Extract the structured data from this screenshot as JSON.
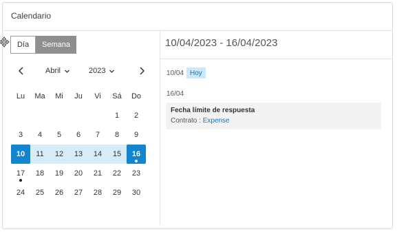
{
  "panel": {
    "title": "Calendario"
  },
  "view_toggle": {
    "day_label": "Día",
    "week_label": "Semana",
    "active": "Semana"
  },
  "month_nav": {
    "month": "Abril",
    "year": "2023",
    "prev_icon": "chevron-left-icon",
    "next_icon": "chevron-right-icon"
  },
  "weekdays": [
    "Lu",
    "Ma",
    "Mi",
    "Ju",
    "Vi",
    "Sá",
    "Do"
  ],
  "weeks": [
    [
      "",
      "",
      "",
      "",
      "",
      "1",
      "2"
    ],
    [
      "3",
      "4",
      "5",
      "6",
      "7",
      "8",
      "9"
    ],
    [
      "10",
      "11",
      "12",
      "13",
      "14",
      "15",
      "16"
    ],
    [
      "17",
      "18",
      "19",
      "20",
      "21",
      "22",
      "23"
    ],
    [
      "24",
      "25",
      "26",
      "27",
      "28",
      "29",
      "30"
    ]
  ],
  "selected_week": {
    "start": "10",
    "end": "16"
  },
  "event_day_markers": [
    "16",
    "17"
  ],
  "colors": {
    "accent": "#1185d0",
    "band": "#d6ecf8",
    "badge": "#cfe8f8"
  },
  "agenda": {
    "range": "10/04/2023 - 16/04/2023",
    "today_date": "10/04",
    "today_badge": "Hoy",
    "event_date": "16/04",
    "event": {
      "title": "Fecha límite de respuesta",
      "type_label": "Contrato :",
      "link": "Expense"
    }
  }
}
